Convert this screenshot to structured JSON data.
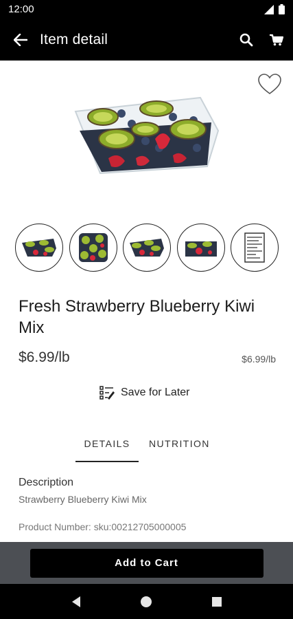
{
  "status_bar": {
    "time": "12:00"
  },
  "app_bar": {
    "title": "Item detail"
  },
  "product": {
    "title": "Fresh Strawberry Blueberry Kiwi Mix",
    "price": "$6.99/lb",
    "unit_price": "$6.99/lb"
  },
  "save_for_later": {
    "label": "Save for Later"
  },
  "tabs": [
    {
      "label": "DETAILS",
      "active": true
    },
    {
      "label": "NUTRITION",
      "active": false
    }
  ],
  "details": {
    "description_label": "Description",
    "description_value": "Strawberry Blueberry Kiwi Mix",
    "product_number": "Product Number: sku:00212705000005"
  },
  "cart": {
    "add_label": "Add to Cart"
  },
  "colors": {
    "app_bar": "#000000",
    "cart_bar": "#4c4f54",
    "button": "#000000"
  },
  "icons": [
    "back-arrow-icon",
    "search-icon",
    "cart-icon",
    "heart-icon",
    "checklist-icon",
    "nav-back-icon",
    "nav-home-icon",
    "nav-recents-icon"
  ]
}
